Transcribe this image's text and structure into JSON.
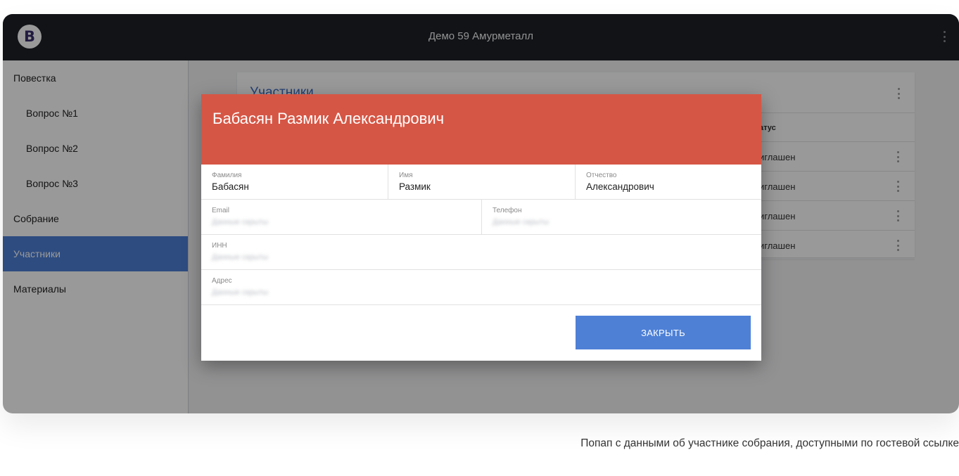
{
  "app": {
    "logo_letter": "B",
    "title": "Демо 59 Амурметалл"
  },
  "sidebar": {
    "items": [
      {
        "label": "Повестка"
      },
      {
        "label": "Вопрос №1"
      },
      {
        "label": "Вопрос №2"
      },
      {
        "label": "Вопрос №3"
      },
      {
        "label": "Собрание"
      },
      {
        "label": "Участники"
      },
      {
        "label": "Материалы"
      }
    ],
    "active": "Участники"
  },
  "card": {
    "title": "Участники",
    "status_header": "атус",
    "rows": [
      {
        "status": "иглашен"
      },
      {
        "status": "иглашен"
      },
      {
        "status": "иглашен"
      },
      {
        "status": "иглашен"
      }
    ]
  },
  "modal": {
    "title": "Бабасян Размик Александрович",
    "last_name_label": "Фамилия",
    "last_name": "Бабасян",
    "first_name_label": "Имя",
    "first_name": "Размик",
    "patronymic_label": "Отчество",
    "patronymic": "Александрович",
    "email_label": "Email",
    "phone_label": "Телефон",
    "inn_label": "ИНН",
    "address_label": "Адрес",
    "hidden_text": "Данные скрыты",
    "close_label": "ЗАКРЫТЬ"
  },
  "caption": "Попап с данными об участнике собрания, доступными по гостевой ссылке",
  "colors": {
    "topbar": "#1d2027",
    "accent_blue": "#4e80d6",
    "modal_header_red": "#d65645"
  }
}
